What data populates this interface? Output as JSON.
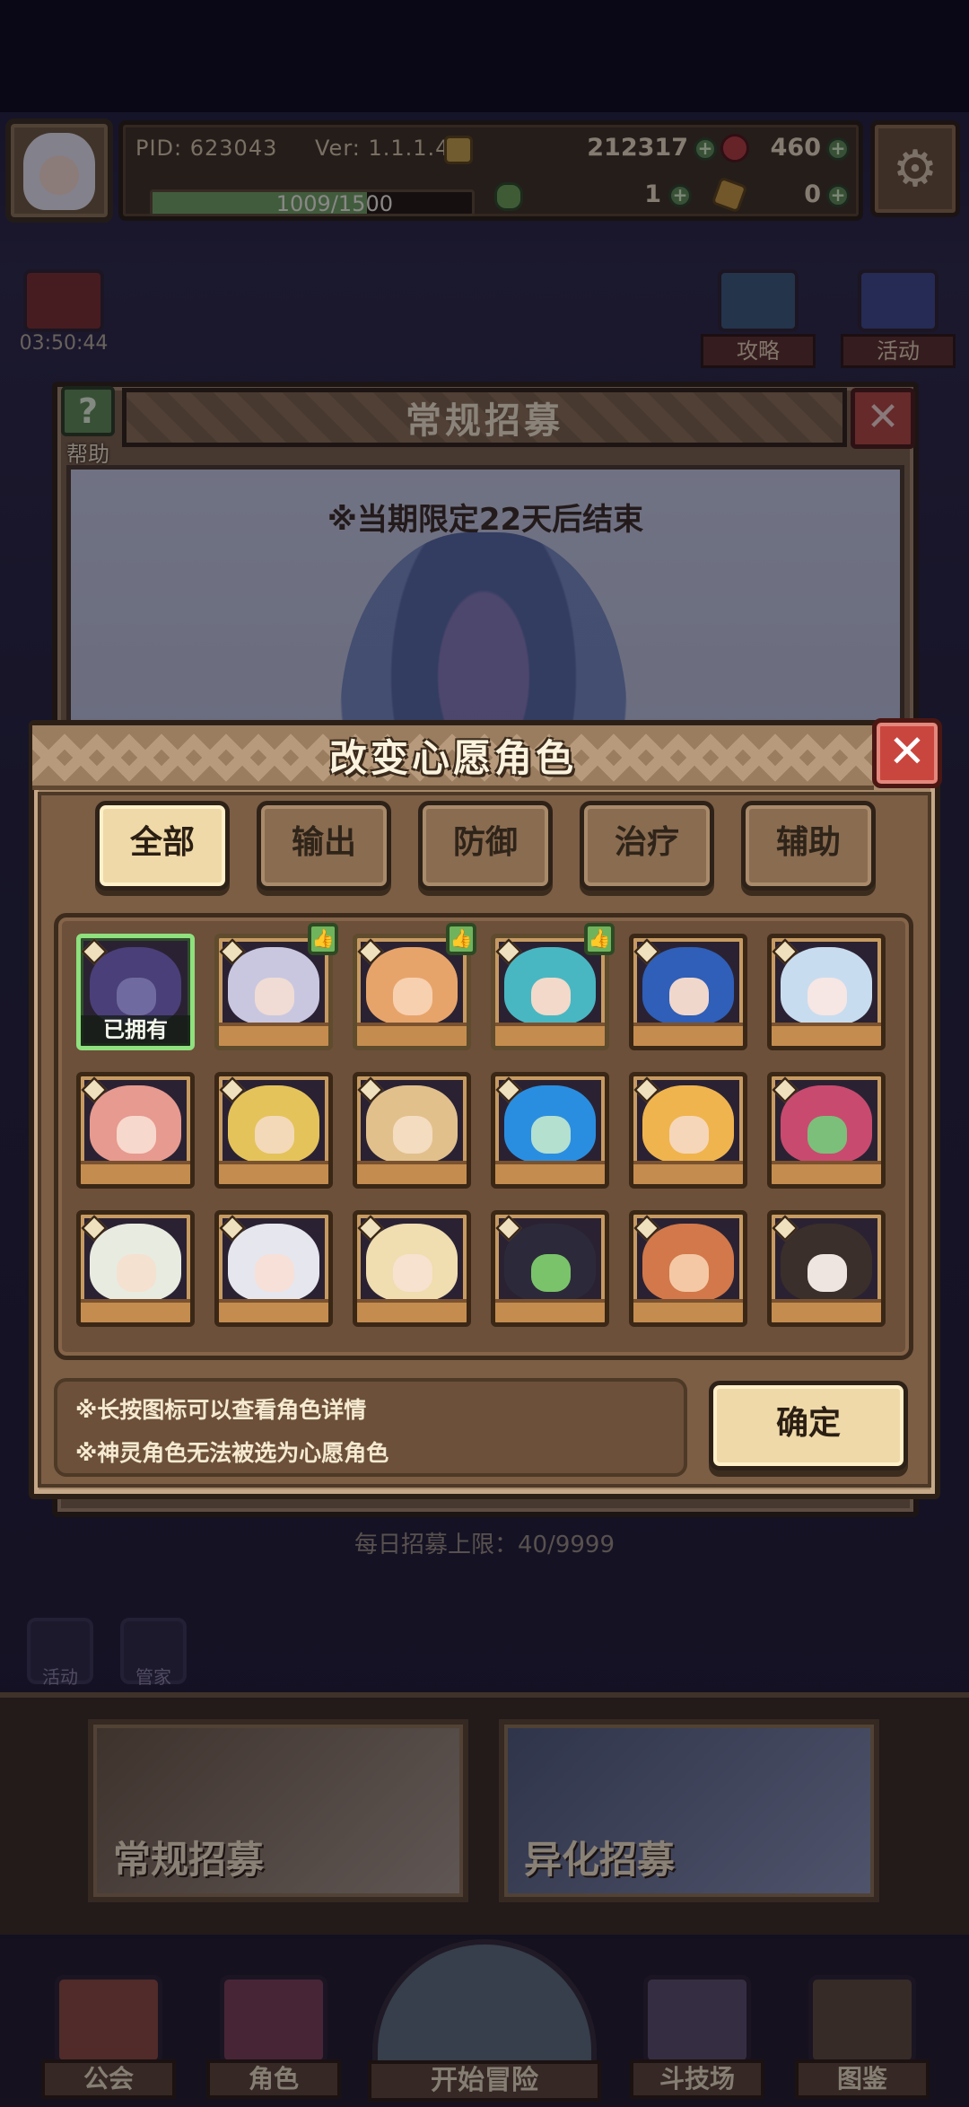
{
  "hud": {
    "pid": "PID: 623043",
    "version": "Ver: 1.1.1.4",
    "gold": "212317",
    "gems": "460",
    "exp": "1009/1500",
    "exp_fraction": 0.6727,
    "clover": "1",
    "other": "0"
  },
  "side": {
    "timer": "03:50:44",
    "guide": "攻略",
    "event": "活动"
  },
  "recruit": {
    "title": "常规招募",
    "help": "帮助",
    "notice": "※当期限定22天后结束",
    "daily_limit": "每日招募上限：40/9999",
    "mini_left": "活动",
    "mini_right": "管家"
  },
  "banners": {
    "normal": "常规招募",
    "alien": "异化招募"
  },
  "nav": {
    "guild": "公会",
    "roles": "角色",
    "adventure": "开始冒险",
    "arena": "斗技场",
    "codex": "图鉴"
  },
  "modal": {
    "title": "改变心愿角色",
    "tabs": [
      "全部",
      "输出",
      "防御",
      "治疗",
      "辅助"
    ],
    "active_tab": 0,
    "owned_label": "已拥有",
    "note1": "※长按图标可以查看角色详情",
    "note2": "※神灵角色无法被选为心愿角色",
    "confirm": "确定",
    "characters": [
      {
        "owned": true,
        "liked": false,
        "hair": "#4a3f78",
        "skin": "#6f6aa0"
      },
      {
        "owned": false,
        "liked": true,
        "hair": "#c9c7e0",
        "skin": "#f0dcd4"
      },
      {
        "owned": false,
        "liked": true,
        "hair": "#e7a46a",
        "skin": "#f7d0b0"
      },
      {
        "owned": false,
        "liked": true,
        "hair": "#49b7c2",
        "skin": "#f3d9c9"
      },
      {
        "owned": false,
        "liked": false,
        "hair": "#2f5fb8",
        "skin": "#f0d7cc"
      },
      {
        "owned": false,
        "liked": false,
        "hair": "#c8dcef",
        "skin": "#f6e6e4"
      },
      {
        "owned": false,
        "liked": false,
        "hair": "#e79a8f",
        "skin": "#f7d8cc"
      },
      {
        "owned": false,
        "liked": false,
        "hair": "#e4c35a",
        "skin": "#f3d9b8"
      },
      {
        "owned": false,
        "liked": false,
        "hair": "#e1c08c",
        "skin": "#f4dcc0"
      },
      {
        "owned": false,
        "liked": false,
        "hair": "#2a8ee0",
        "skin": "#b4e0d0"
      },
      {
        "owned": false,
        "liked": false,
        "hair": "#f0b44e",
        "skin": "#f6d6b8"
      },
      {
        "owned": false,
        "liked": false,
        "hair": "#c94a6f",
        "skin": "#7cbf7a"
      },
      {
        "owned": false,
        "liked": false,
        "hair": "#e8ebe0",
        "skin": "#f5e1d0"
      },
      {
        "owned": false,
        "liked": false,
        "hair": "#e6e6ee",
        "skin": "#f6e0d8"
      },
      {
        "owned": false,
        "liked": false,
        "hair": "#f0ddb0",
        "skin": "#f7e2cf"
      },
      {
        "owned": false,
        "liked": false,
        "hair": "#2c2a3a",
        "skin": "#7ac36a"
      },
      {
        "owned": false,
        "liked": false,
        "hair": "#d2784a",
        "skin": "#f4c8a4"
      },
      {
        "owned": false,
        "liked": false,
        "hair": "#3a2f2a",
        "skin": "#eee4e0"
      }
    ]
  },
  "colors": {
    "accent_gold": "#efd9a8",
    "close_red": "#c9463f",
    "owned_green": "#8fe07e",
    "plus_green": "#5f8d55"
  }
}
